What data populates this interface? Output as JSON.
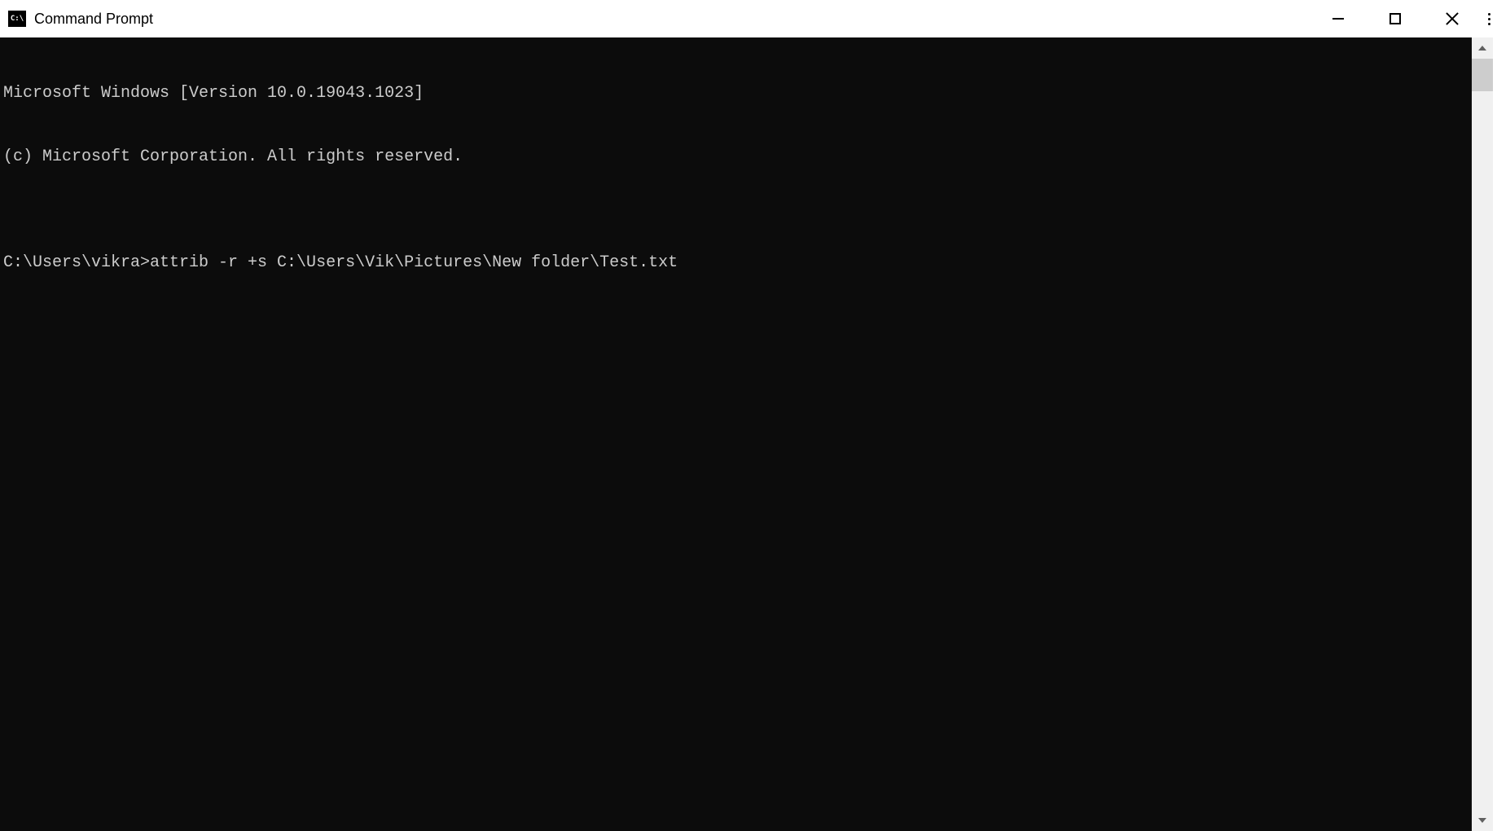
{
  "window": {
    "title": "Command Prompt",
    "icon_label": "C:\\"
  },
  "terminal": {
    "lines": [
      "Microsoft Windows [Version 10.0.19043.1023]",
      "(c) Microsoft Corporation. All rights reserved.",
      "",
      "C:\\Users\\vikra>attrib -r +s C:\\Users\\Vik\\Pictures\\New folder\\Test.txt"
    ],
    "prompt": "C:\\Users\\vikra>",
    "command": "attrib -r +s C:\\Users\\Vik\\Pictures\\New folder\\Test.txt"
  }
}
